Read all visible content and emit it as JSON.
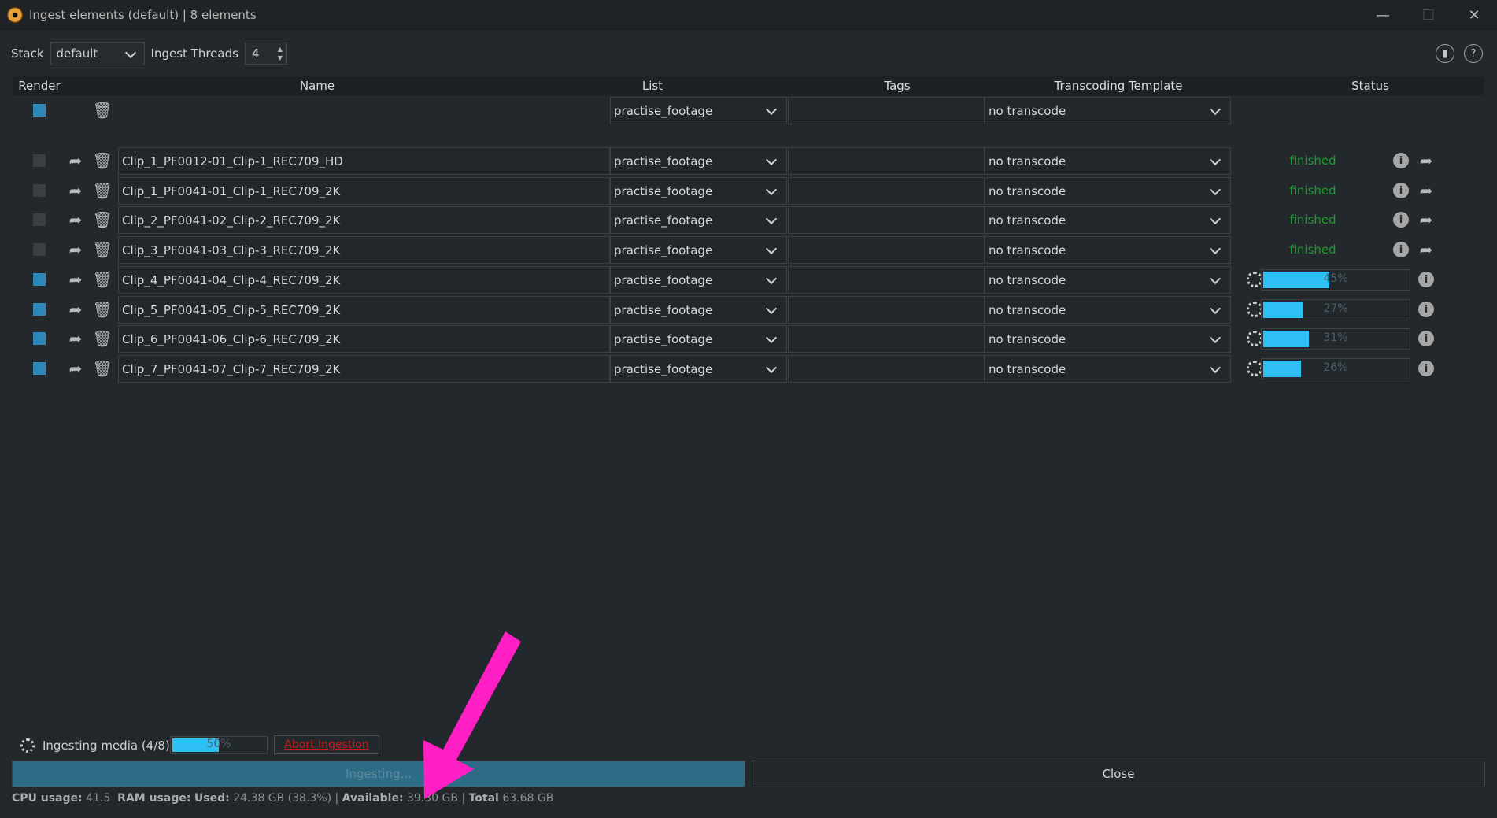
{
  "window": {
    "title": "Ingest elements (default) | 8 elements",
    "controls": {
      "minimize": "—",
      "maximize": "☐",
      "close": "✕"
    }
  },
  "toolbar": {
    "stack_label": "Stack",
    "stack_value": "default",
    "threads_label": "Ingest Threads",
    "threads_value": "4",
    "help_label": "?"
  },
  "columns": {
    "render": "Render",
    "name": "Name",
    "list": "List",
    "tags": "Tags",
    "template": "Transcoding Template",
    "status": "Status"
  },
  "defaults_row": {
    "render": true,
    "list": "practise_footage",
    "tags": "",
    "template": "no transcode"
  },
  "rows": [
    {
      "render": false,
      "name": "Clip_1_PF0012-01_Clip-1_REC709_HD",
      "list": "practise_footage",
      "tags": "",
      "template": "no transcode",
      "state": "finished",
      "status": "finished"
    },
    {
      "render": false,
      "name": "Clip_1_PF0041-01_Clip-1_REC709_2K",
      "list": "practise_footage",
      "tags": "",
      "template": "no transcode",
      "state": "finished",
      "status": "finished"
    },
    {
      "render": false,
      "name": "Clip_2_PF0041-02_Clip-2_REC709_2K",
      "list": "practise_footage",
      "tags": "",
      "template": "no transcode",
      "state": "finished",
      "status": "finished"
    },
    {
      "render": false,
      "name": "Clip_3_PF0041-03_Clip-3_REC709_2K",
      "list": "practise_footage",
      "tags": "",
      "template": "no transcode",
      "state": "finished",
      "status": "finished"
    },
    {
      "render": true,
      "name": "Clip_4_PF0041-04_Clip-4_REC709_2K",
      "list": "practise_footage",
      "tags": "",
      "template": "no transcode",
      "state": "progress",
      "progress": 45,
      "status": "45%"
    },
    {
      "render": true,
      "name": "Clip_5_PF0041-05_Clip-5_REC709_2K",
      "list": "practise_footage",
      "tags": "",
      "template": "no transcode",
      "state": "progress",
      "progress": 27,
      "status": "27%"
    },
    {
      "render": true,
      "name": "Clip_6_PF0041-06_Clip-6_REC709_2K",
      "list": "practise_footage",
      "tags": "",
      "template": "no transcode",
      "state": "progress",
      "progress": 31,
      "status": "31%"
    },
    {
      "render": true,
      "name": "Clip_7_PF0041-07_Clip-7_REC709_2K",
      "list": "practise_footage",
      "tags": "",
      "template": "no transcode",
      "state": "progress",
      "progress": 26,
      "status": "26%"
    }
  ],
  "footer": {
    "ingest_status": "Ingesting media (4/8)",
    "overall_progress": 50,
    "overall_progress_text": "50%",
    "abort_label": "Abort Ingestion",
    "ingest_button": "Ingesting...",
    "close_button": "Close"
  },
  "system": {
    "cpu_label": "CPU usage:",
    "cpu_value": "41.5",
    "ram_label": "RAM usage:",
    "used_label": "Used:",
    "used_value": "24.38 GB (38.3%)",
    "sep": "|",
    "available_label": "Available:",
    "available_value": "39.30 GB",
    "total_label": "Total",
    "total_value": "63.68 GB"
  },
  "colors": {
    "accent": "#2f87b8",
    "progress": "#2ec0f5",
    "finished": "#1c9c2b",
    "abort": "#c31b1b",
    "annotation_arrow": "#ff1fc4"
  }
}
